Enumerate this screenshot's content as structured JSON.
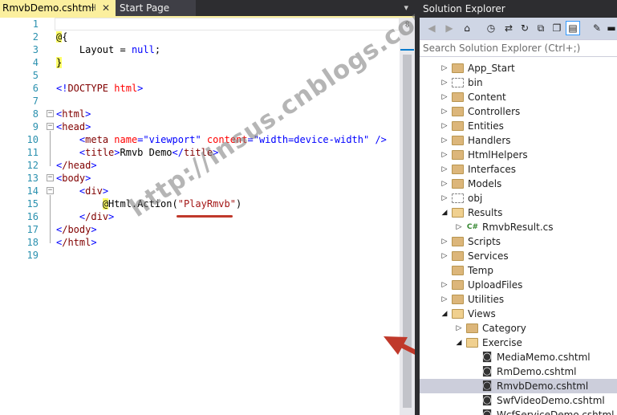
{
  "tabs": [
    {
      "label": "RmvbDemo.cshtml",
      "active": true
    },
    {
      "label": "Start Page",
      "active": false
    }
  ],
  "editor": {
    "line_numbers": [
      "1",
      "2",
      "3",
      "4",
      "5",
      "6",
      "7",
      "8",
      "9",
      "10",
      "11",
      "12",
      "13",
      "14",
      "15",
      "16",
      "17",
      "18",
      "19"
    ],
    "code": {
      "l2_at": "@",
      "l2_brace": "{",
      "l3_indent": "    ",
      "l3_kw": "Layout",
      "l3_eq": " = ",
      "l3_null": "null",
      "l3_semi": ";",
      "l4_brace": "}",
      "l6_open": "<!",
      "l6_doctype": "DOCTYPE",
      "l6_sp": " ",
      "l6_html": "html",
      "l6_close": ">",
      "l8_open": "<",
      "l8_tag": "html",
      "l8_close": ">",
      "l9_tag": "head",
      "l10_indent": "    ",
      "l10_tag": "meta",
      "l10_attr1": "name",
      "l10_eq": "=",
      "l10_val1": "\"viewport\"",
      "l10_attr2": "content",
      "l10_val2": "\"width=device-width\"",
      "l10_end": " />",
      "l11_tag": "title",
      "l11_text": "Rmvb Demo",
      "l11_endtag": "title",
      "l12_tag": "/head",
      "l13_tag": "body",
      "l14_tag": "div",
      "l15_indent": "        ",
      "l15_at": "@",
      "l15_call": "Html.Action(",
      "l15_str": "\"PlayRmvb\"",
      "l15_paren": ")",
      "l16_tag": "/div",
      "l17_tag": "/body",
      "l18_tag": "/html"
    }
  },
  "watermark": "http://insus.cnblogs.com",
  "explorer": {
    "title": "Solution Explorer",
    "search_placeholder": "Search Solution Explorer (Ctrl+;)",
    "icons": [
      "back-icon",
      "forward-icon",
      "home-icon",
      "history-icon",
      "sync-icon",
      "refresh-icon",
      "collapse-all-icon",
      "show-all-files-icon",
      "properties-icon",
      "preview-icon"
    ],
    "items": [
      {
        "label": "App_Start",
        "type": "folder",
        "level": 0,
        "expander": "collapsed"
      },
      {
        "label": "bin",
        "type": "folder-hidden",
        "level": 0,
        "expander": "collapsed"
      },
      {
        "label": "Content",
        "type": "folder",
        "level": 0,
        "expander": "collapsed"
      },
      {
        "label": "Controllers",
        "type": "folder",
        "level": 0,
        "expander": "collapsed"
      },
      {
        "label": "Entities",
        "type": "folder",
        "level": 0,
        "expander": "collapsed"
      },
      {
        "label": "Handlers",
        "type": "folder",
        "level": 0,
        "expander": "collapsed"
      },
      {
        "label": "HtmlHelpers",
        "type": "folder",
        "level": 0,
        "expander": "collapsed"
      },
      {
        "label": "Interfaces",
        "type": "folder",
        "level": 0,
        "expander": "collapsed"
      },
      {
        "label": "Models",
        "type": "folder",
        "level": 0,
        "expander": "collapsed"
      },
      {
        "label": "obj",
        "type": "folder-hidden",
        "level": 0,
        "expander": "collapsed"
      },
      {
        "label": "Results",
        "type": "folder-open",
        "level": 0,
        "expander": "expanded"
      },
      {
        "label": "RmvbResult.cs",
        "type": "cs",
        "level": 1,
        "expander": "collapsed"
      },
      {
        "label": "Scripts",
        "type": "folder",
        "level": 0,
        "expander": "collapsed"
      },
      {
        "label": "Services",
        "type": "folder",
        "level": 0,
        "expander": "collapsed"
      },
      {
        "label": "Temp",
        "type": "folder",
        "level": 0,
        "expander": "none"
      },
      {
        "label": "UploadFiles",
        "type": "folder",
        "level": 0,
        "expander": "collapsed"
      },
      {
        "label": "Utilities",
        "type": "folder",
        "level": 0,
        "expander": "collapsed"
      },
      {
        "label": "Views",
        "type": "folder-open",
        "level": 0,
        "expander": "expanded"
      },
      {
        "label": "Category",
        "type": "folder",
        "level": 1,
        "expander": "collapsed"
      },
      {
        "label": "Exercise",
        "type": "folder-open",
        "level": 1,
        "expander": "expanded"
      },
      {
        "label": "MediaMemo.cshtml",
        "type": "razor",
        "level": 2,
        "expander": "none"
      },
      {
        "label": "RmDemo.cshtml",
        "type": "razor",
        "level": 2,
        "expander": "none"
      },
      {
        "label": "RmvbDemo.cshtml",
        "type": "razor",
        "level": 2,
        "expander": "none",
        "selected": true
      },
      {
        "label": "SwfVideoDemo.cshtml",
        "type": "razor",
        "level": 2,
        "expander": "none"
      },
      {
        "label": "WcfServiceDemo.cshtml",
        "type": "razor",
        "level": 2,
        "expander": "none"
      }
    ]
  },
  "colors": {
    "tab_active": "#fbef9e",
    "line_number": "#2b91af",
    "razor_highlight": "#ffff66",
    "keyword": "#0000ff",
    "tag": "#800000",
    "attribute": "#ff0000",
    "string": "#a31515",
    "annotation": "#c0392b",
    "selection": "#cccedb"
  }
}
